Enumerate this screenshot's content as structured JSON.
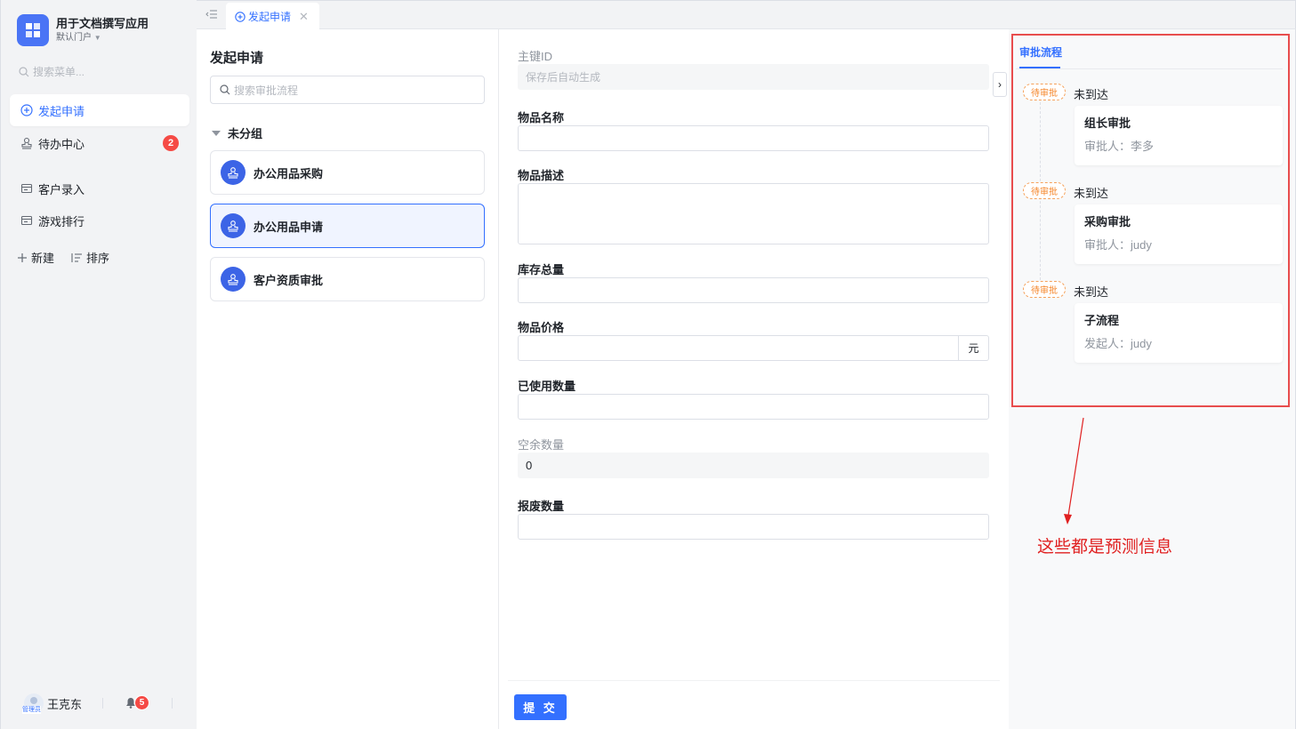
{
  "app": {
    "name": "用于文档撰写应用",
    "portal": "默认门户"
  },
  "sidebar": {
    "search_placeholder": "搜索菜单...",
    "items": [
      {
        "label": "发起申请",
        "icon": "plus-circle-icon",
        "active": true
      },
      {
        "label": "待办中心",
        "icon": "stamp-icon",
        "badge": "2"
      },
      {
        "label": "客户录入",
        "icon": "form-icon"
      },
      {
        "label": "游戏排行",
        "icon": "form-icon"
      }
    ],
    "new_label": "新建",
    "sort_label": "排序",
    "user_name": "王克东",
    "user_role": "管理员",
    "notification_count": "5"
  },
  "tabs": [
    {
      "label": "发起申请",
      "closable": true
    }
  ],
  "flow_panel": {
    "title": "发起申请",
    "search_placeholder": "搜索审批流程",
    "group": "未分组",
    "flows": [
      {
        "label": "办公用品采购"
      },
      {
        "label": "办公用品申请",
        "selected": true
      },
      {
        "label": "客户资质审批"
      }
    ]
  },
  "form": {
    "fields": [
      {
        "label": "主键ID",
        "value": "保存后自动生成",
        "readonly": true
      },
      {
        "label": "物品名称",
        "value": ""
      },
      {
        "label": "物品描述",
        "value": ""
      },
      {
        "label": "库存总量",
        "value": ""
      },
      {
        "label": "物品价格",
        "value": "",
        "suffix": "元"
      },
      {
        "label": "已使用数量",
        "value": ""
      },
      {
        "label": "空余数量",
        "value": "0",
        "readonly": true
      },
      {
        "label": "报废数量",
        "value": ""
      }
    ],
    "submit_label": "提 交"
  },
  "approval": {
    "tab_label": "审批流程",
    "steps": [
      {
        "tag": "待审批",
        "status": "未到达",
        "name": "组长审批",
        "person": "审批人：李多"
      },
      {
        "tag": "待审批",
        "status": "未到达",
        "name": "采购审批",
        "person": "审批人：judy"
      },
      {
        "tag": "待审批",
        "status": "未到达",
        "name": "子流程",
        "person": "发起人：judy"
      }
    ]
  },
  "annotation": {
    "text": "这些都是预测信息",
    "color": "#e02020"
  },
  "colors": {
    "accent": "#3370ff",
    "danger": "#f54a45",
    "pending": "#f5862a"
  }
}
